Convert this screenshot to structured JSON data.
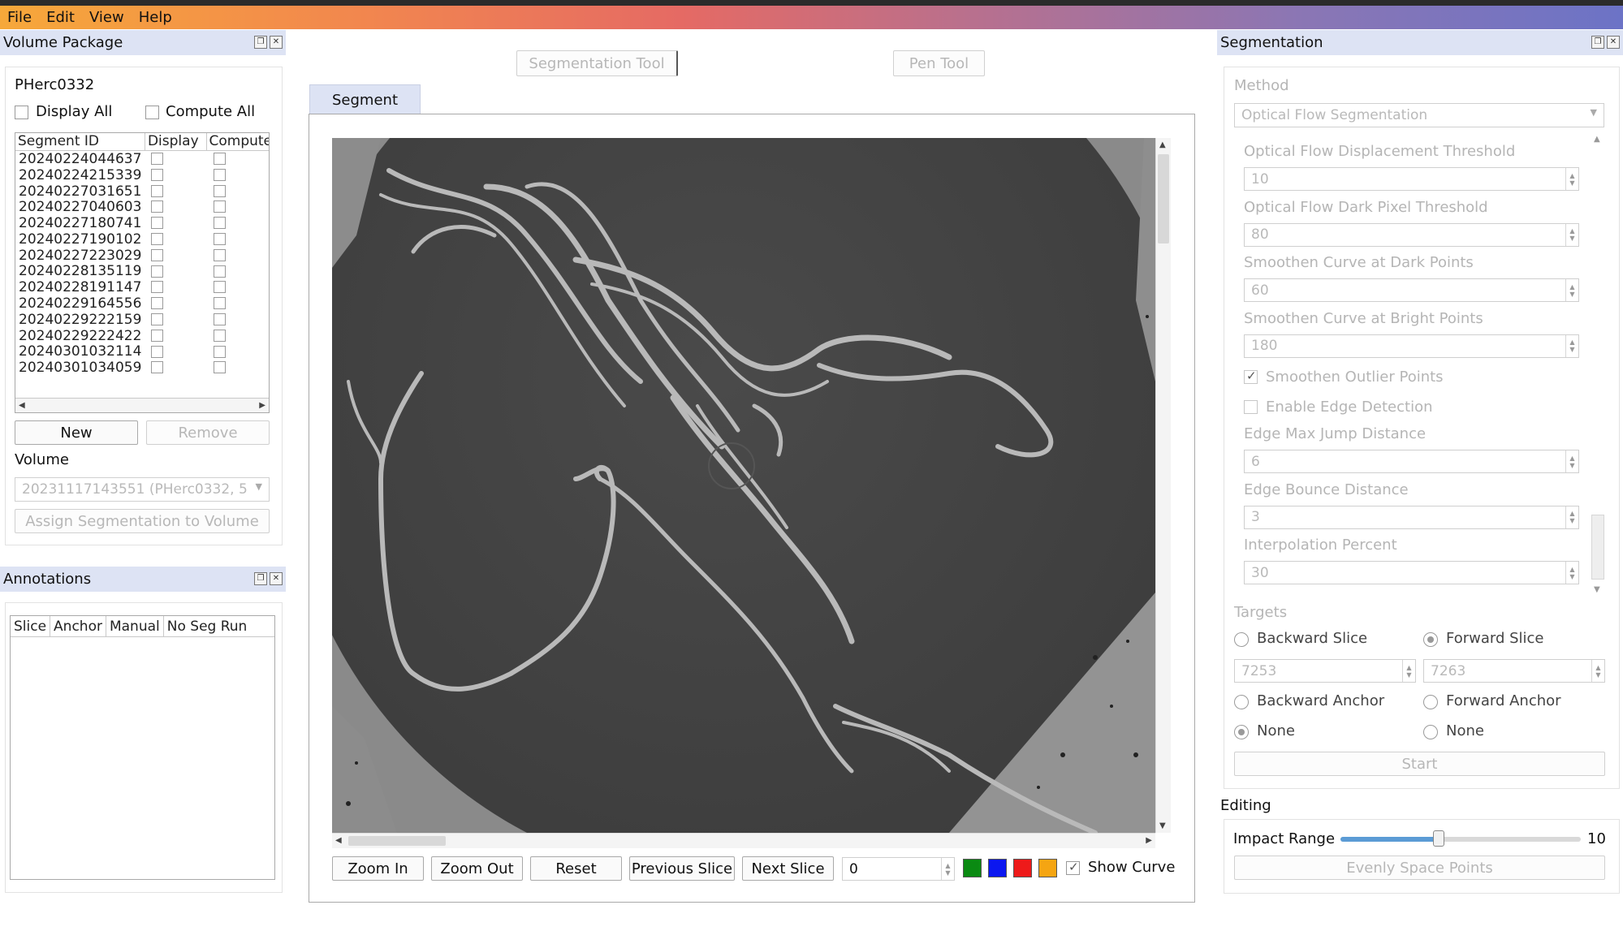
{
  "menu": {
    "file": "File",
    "edit": "Edit",
    "view": "View",
    "help": "Help"
  },
  "volume_package": {
    "title": "Volume Package",
    "package_name": "PHerc0332",
    "display_all": "Display All",
    "compute_all": "Compute All",
    "columns": [
      "Segment ID",
      "Display",
      "Compute"
    ],
    "segments": [
      "20240224044637",
      "20240224215339",
      "20240227031651",
      "20240227040603",
      "20240227180741",
      "20240227190102",
      "20240227223029",
      "20240228135119",
      "20240228191147",
      "20240229164556",
      "20240229222159",
      "20240229222422",
      "20240301032114",
      "20240301034059"
    ],
    "new_button": "New",
    "remove_button": "Remove",
    "volume_label": "Volume",
    "volume_value": "20231117143551 (PHerc0332, 5",
    "assign_button": "Assign Segmentation to Volume"
  },
  "annotations": {
    "title": "Annotations",
    "columns": [
      "Slice",
      "Anchor",
      "Manual",
      "No Seg Run"
    ]
  },
  "tools": {
    "segmentation_tool": "Segmentation Tool",
    "pen_tool": "Pen Tool"
  },
  "viewer": {
    "tab": "Segment",
    "zoom_in": "Zoom In",
    "zoom_out": "Zoom Out",
    "reset": "Reset",
    "previous_slice": "Previous Slice",
    "next_slice": "Next Slice",
    "slice_value": "0",
    "show_curve": "Show Curve",
    "swatches": [
      "#0a8a12",
      "#0b17f0",
      "#ee1a1a",
      "#f5a512"
    ]
  },
  "segmentation": {
    "title": "Segmentation",
    "method_label": "Method",
    "method_value": "Optical Flow Segmentation",
    "params": [
      {
        "label": "Optical Flow Displacement Threshold",
        "value": "10"
      },
      {
        "label": "Optical Flow Dark Pixel Threshold",
        "value": "80"
      },
      {
        "label": "Smoothen Curve at Dark Points",
        "value": "60"
      },
      {
        "label": "Smoothen Curve at Bright Points",
        "value": "180"
      }
    ],
    "smoothen_outlier": "Smoothen Outlier Points",
    "enable_edge": "Enable Edge Detection",
    "params2": [
      {
        "label": "Edge Max Jump Distance",
        "value": "6"
      },
      {
        "label": "Edge Bounce Distance",
        "value": "3"
      },
      {
        "label": "Interpolation Percent",
        "value": "30"
      }
    ],
    "targets_label": "Targets",
    "backward_slice": "Backward Slice",
    "forward_slice": "Forward Slice",
    "backward_slice_value": "7253",
    "forward_slice_value": "7263",
    "backward_anchor": "Backward Anchor",
    "forward_anchor": "Forward Anchor",
    "none_left": "None",
    "none_right": "None",
    "start_button": "Start"
  },
  "editing": {
    "title": "Editing",
    "impact_range_label": "Impact Range",
    "impact_range_value": "10",
    "impact_range_fraction": 0.41,
    "evenly_space": "Evenly Space Points"
  }
}
